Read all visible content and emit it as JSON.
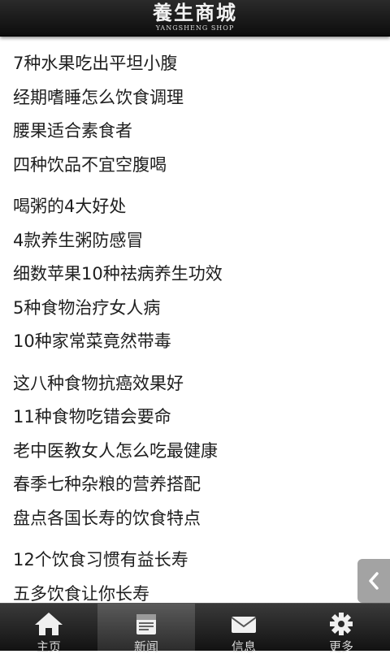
{
  "header": {
    "title_zh": "養生商城",
    "title_en": "YANGSHENG SHOP"
  },
  "articles": [
    [
      "7种水果吃出平坦小腹",
      "经期嗜睡怎么饮食调理",
      "腰果适合素食者",
      "四种饮品不宜空腹喝"
    ],
    [
      "喝粥的4大好处",
      "4款养生粥防感冒",
      "细数苹果10种祛病养生功效",
      "5种食物治疗女人病",
      "10种家常菜竟然带毒"
    ],
    [
      "这八种食物抗癌效果好",
      "11种食物吃错会要命",
      "老中医教女人怎么吃最健康",
      "春季七种杂粮的营养搭配",
      "盘点各国长寿的饮食特点"
    ],
    [
      "12个饮食习惯有益长寿",
      "五多饮食让你长寿"
    ]
  ],
  "side_tab": {
    "icon": "chevron-left-icon"
  },
  "tabbar": {
    "tabs": [
      {
        "label": "主页",
        "icon": "home-icon",
        "active": false
      },
      {
        "label": "新闻",
        "icon": "news-icon",
        "active": true
      },
      {
        "label": "信息",
        "icon": "mail-icon",
        "active": false
      },
      {
        "label": "更多",
        "icon": "gear-icon",
        "active": false
      }
    ]
  },
  "colors": {
    "header_bg": "#1a1a1a",
    "text": "#1e1e1e",
    "tabbar_bg": "#1e1e1e",
    "tab_text": "#d8d8d8"
  }
}
